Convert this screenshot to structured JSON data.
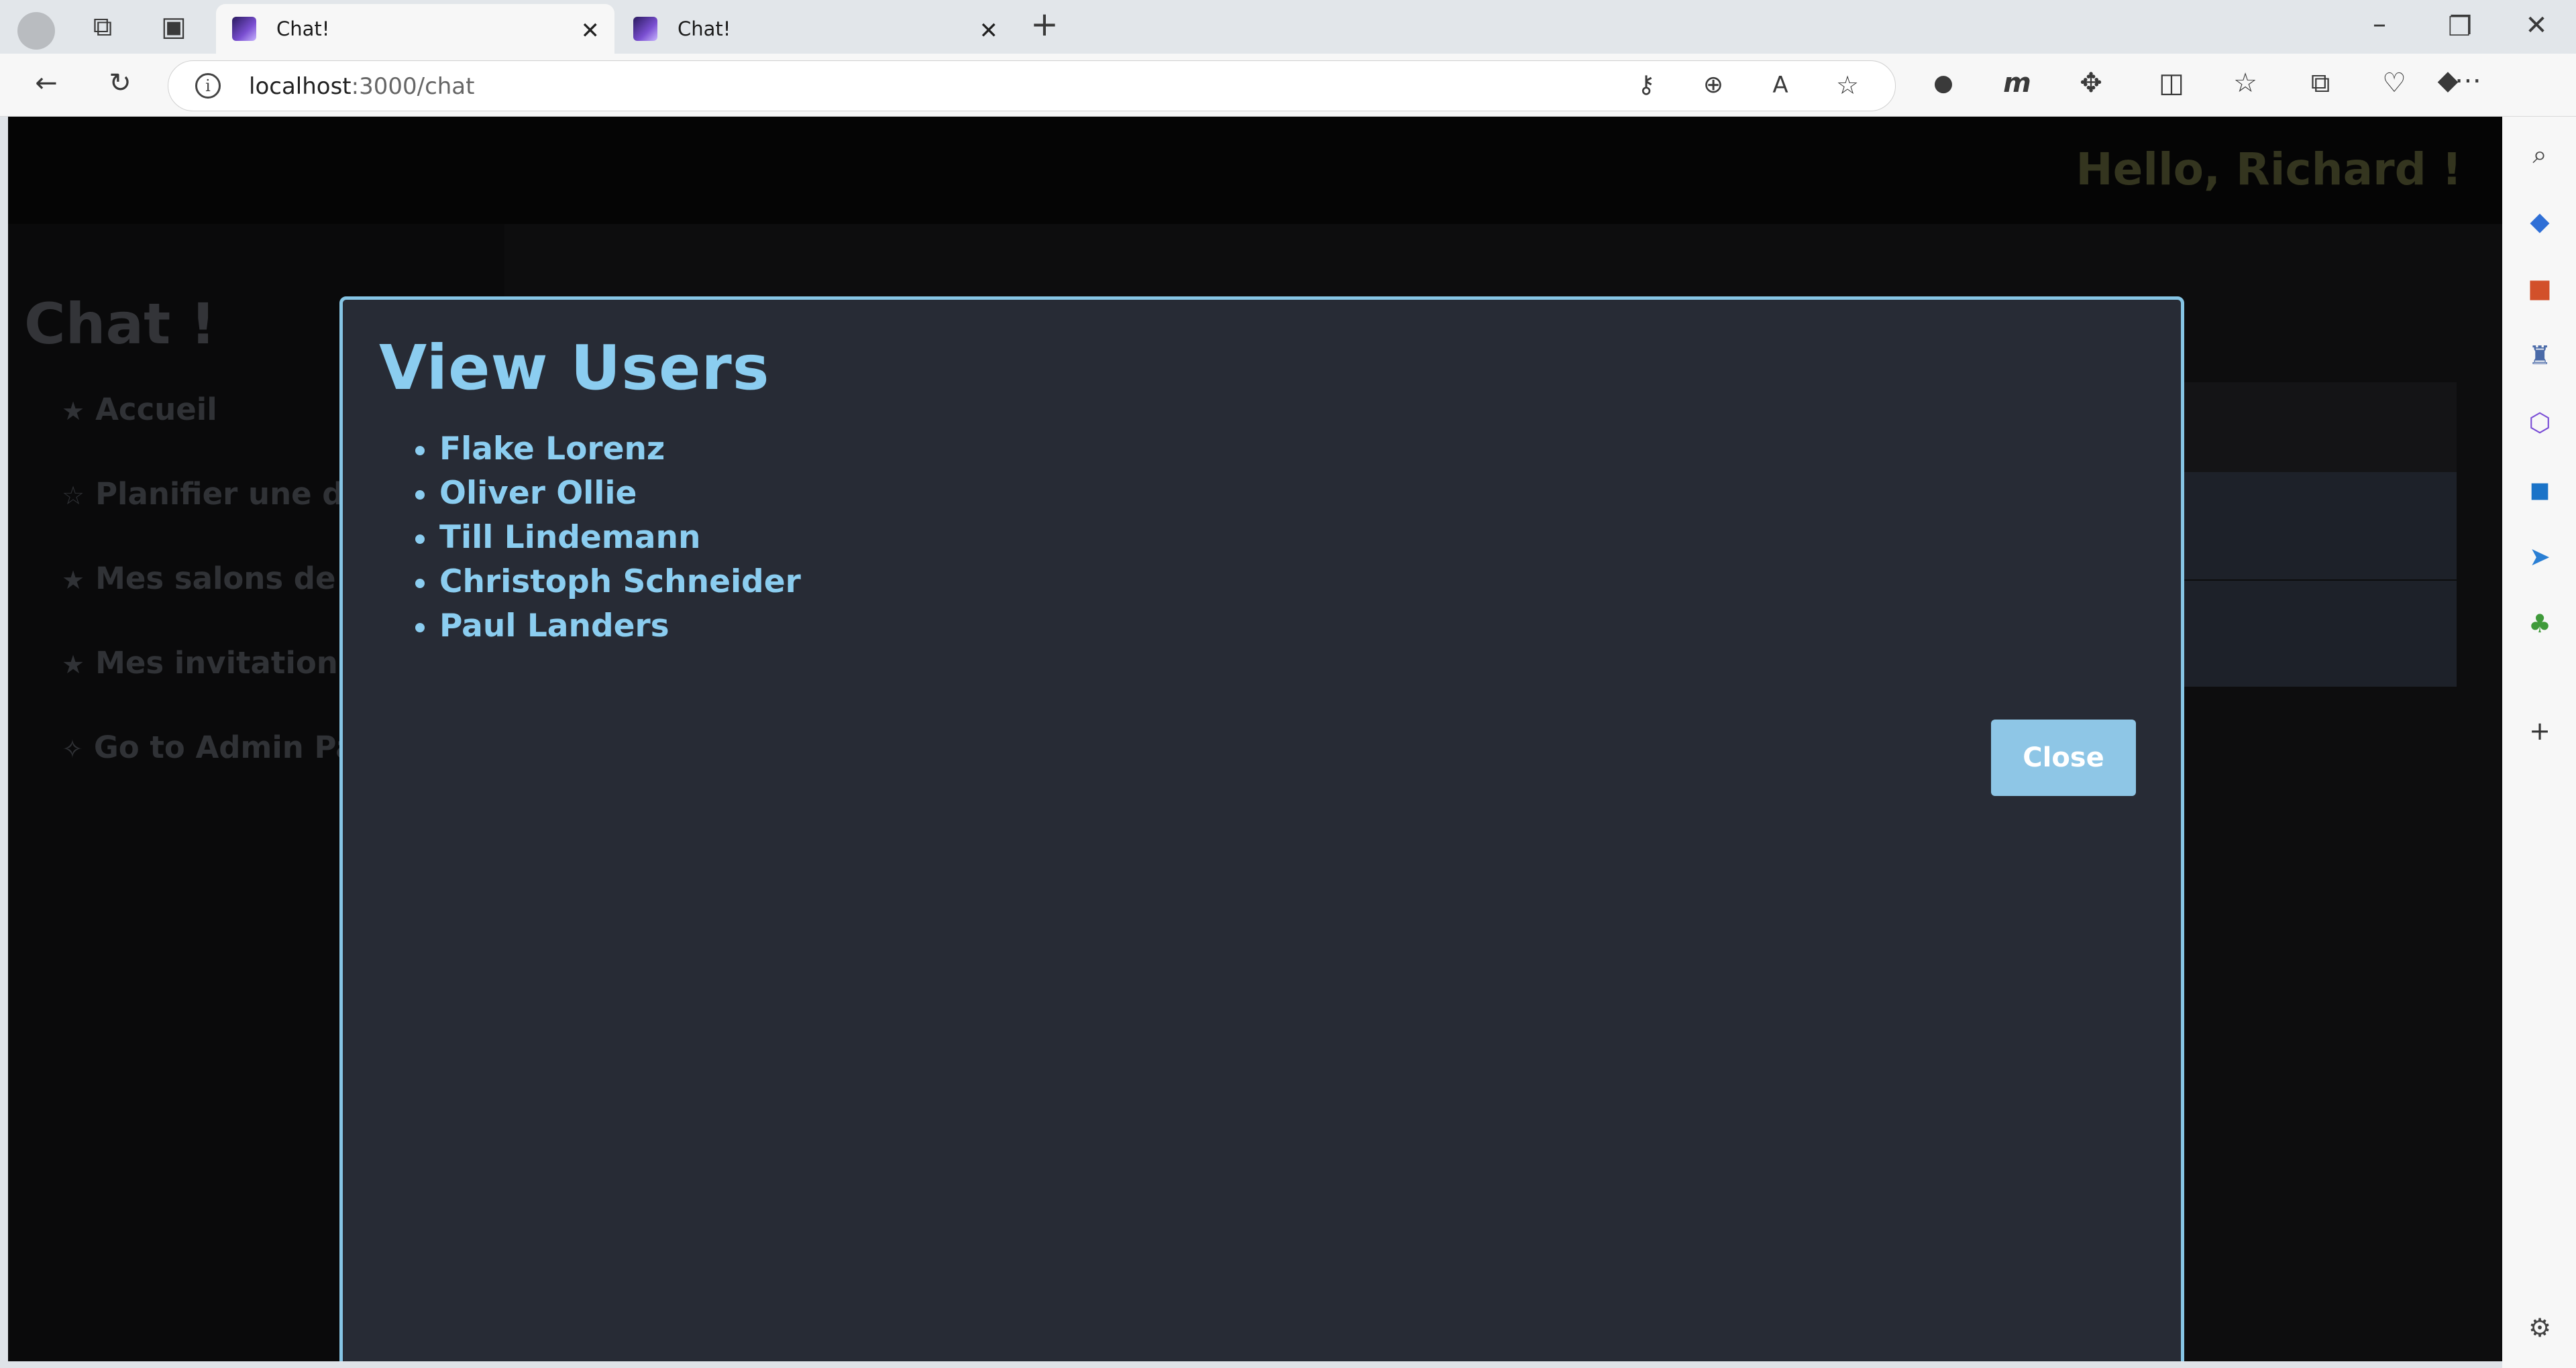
{
  "browser": {
    "tabs": [
      {
        "title": "Chat!",
        "active": true
      },
      {
        "title": "Chat!",
        "active": false
      }
    ],
    "url_host": "localhost",
    "url_path": ":3000/chat",
    "url_info_glyph": "i",
    "new_tab_glyph": "+"
  },
  "header": {
    "greeting": "Hello, Richard !"
  },
  "sidebar": {
    "title": "Chat !",
    "items": [
      {
        "icon": "★",
        "label": "Accueil"
      },
      {
        "icon": "☆",
        "label": "Planifier une dis"
      },
      {
        "icon": "★",
        "label": "Mes salons de d"
      },
      {
        "icon": "★",
        "label": "Mes invitations"
      },
      {
        "icon": "✧",
        "label": "Go to Admin Pag"
      }
    ]
  },
  "modal": {
    "title": "View Users",
    "users": [
      "Flake Lorenz",
      "Oliver Ollie",
      "Till Lindemann",
      "Christoph Schneider",
      "Paul Landers"
    ],
    "close_label": "Close"
  },
  "colors": {
    "accent": "#8bcdf0",
    "modal_bg": "#272b35",
    "button": "#8ec6e6"
  }
}
